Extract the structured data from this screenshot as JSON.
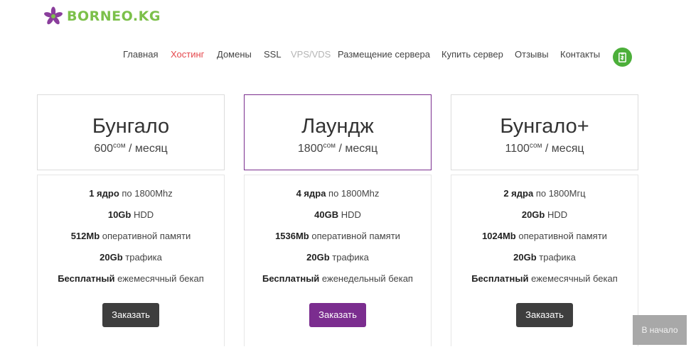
{
  "logo": {
    "text": "BORNEO.KG",
    "color": "#7cc04a",
    "icon": "flower-logo-icon"
  },
  "nav": {
    "items": [
      {
        "label": "Главная",
        "state": "normal"
      },
      {
        "label": "Хостинг",
        "state": "active"
      },
      {
        "label": "Домены",
        "state": "normal"
      },
      {
        "label": "SSL",
        "state": "normal"
      },
      {
        "label": "VPS/VDS",
        "state": "disabled"
      },
      {
        "label": "Размещение сервера",
        "state": "normal"
      },
      {
        "label": "Купить сервер",
        "state": "normal"
      },
      {
        "label": "Отзывы",
        "state": "normal"
      },
      {
        "label": "Контакты",
        "state": "normal"
      }
    ],
    "cart_icon": "cart-list-icon"
  },
  "colors": {
    "active_link": "#e5484d",
    "accent": "#7b2d8f",
    "cart_bg": "#4caf3a",
    "button_dark": "#3e3e3e"
  },
  "plans": [
    {
      "title": "Бунгало",
      "price": "600",
      "currency": "сом",
      "period": " / месяц",
      "features": [
        {
          "bold": "1 ядро",
          "rest": " по 1800Mhz"
        },
        {
          "bold": "10Gb",
          "rest": " HDD"
        },
        {
          "bold": "512Mb",
          "rest": " оперативной памяти"
        },
        {
          "bold": "20Gb",
          "rest": " трафика"
        },
        {
          "bold": "Бесплатный",
          "rest": " ежемесячный бекап"
        }
      ],
      "button": "Заказать"
    },
    {
      "title": "Лаундж",
      "price": "1800",
      "currency": "сом",
      "period": " / месяц",
      "features": [
        {
          "bold": "4 ядра",
          "rest": " по 1800Mhz"
        },
        {
          "bold": "40GB",
          "rest": " HDD"
        },
        {
          "bold": "1536Mb",
          "rest": " оперативной памяти"
        },
        {
          "bold": "20Gb",
          "rest": " трафика"
        },
        {
          "bold": "Бесплатный",
          "rest": " еженедельный бекап"
        }
      ],
      "button": "Заказать"
    },
    {
      "title": "Бунгало+",
      "price": "1100",
      "currency": "сом",
      "period": " / месяц",
      "features": [
        {
          "bold": "2 ядра",
          "rest": " по 1800Мгц"
        },
        {
          "bold": "20Gb",
          "rest": " HDD"
        },
        {
          "bold": "1024Mb",
          "rest": " оперативной памяти"
        },
        {
          "bold": "20Gb",
          "rest": " трафика"
        },
        {
          "bold": "Бесплатный",
          "rest": " ежемесячный бекап"
        }
      ],
      "button": "Заказать"
    }
  ],
  "to_top": "В начало"
}
